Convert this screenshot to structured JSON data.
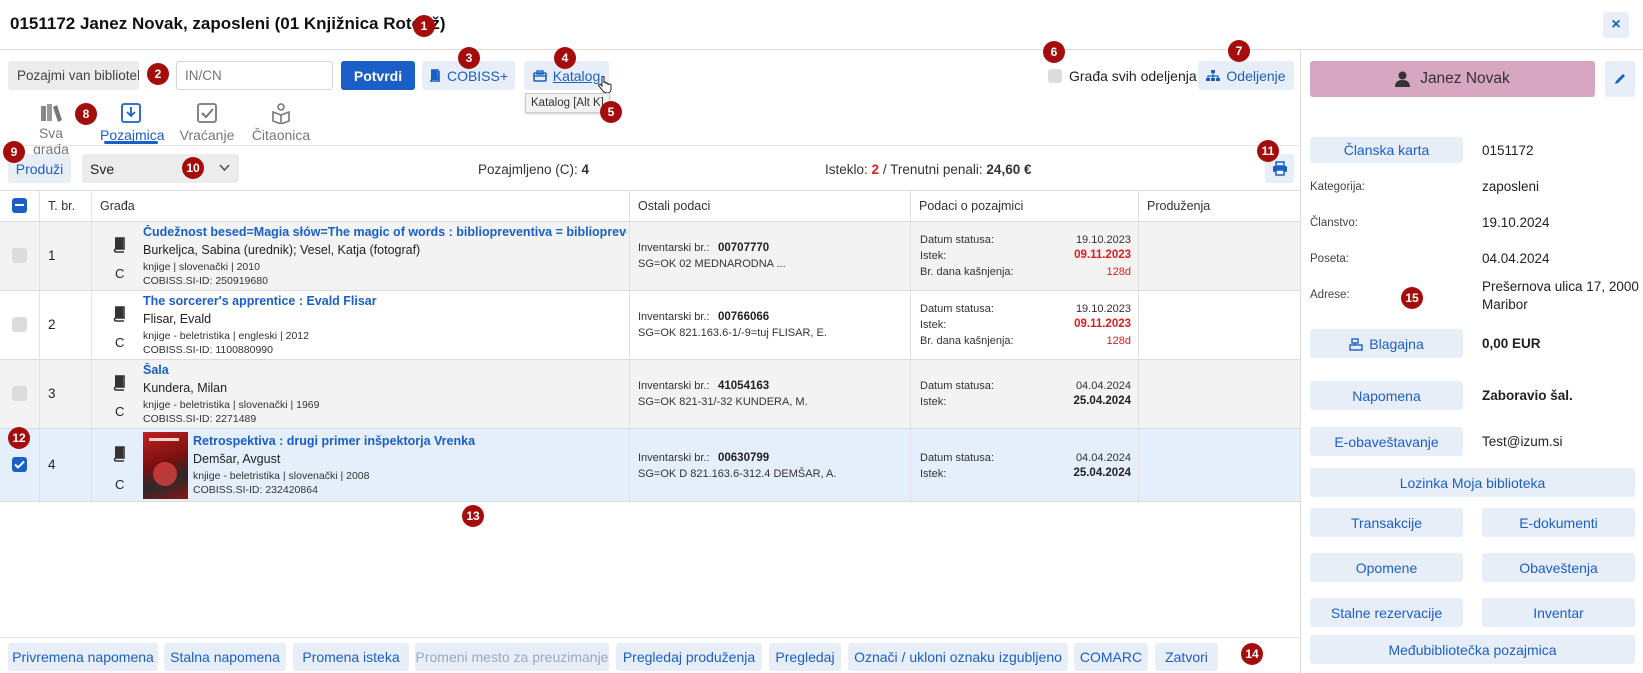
{
  "header": {
    "title": "0151172 Janez Novak, zaposleni (01 Knjižnica Rotovž)",
    "close_label": "×"
  },
  "toolbar": {
    "loan_select_value": "Pozajmi van bibliotek",
    "incn_placeholder": "IN/CN",
    "confirm_label": "Potvrdi",
    "cobiss_label": "COBISS+",
    "catalog_label": "Katalog",
    "catalog_tooltip": "Katalog [Alt K]",
    "all_departments_label": "Građa svih odeljenja",
    "department_label": "Odeljenje"
  },
  "tabs": [
    {
      "label": "Sva građa",
      "icon": "books-icon"
    },
    {
      "label": "Pozajmica",
      "icon": "download-icon"
    },
    {
      "label": "Vraćanje",
      "icon": "checkbox-icon"
    },
    {
      "label": "Čitaonica",
      "icon": "reader-icon"
    }
  ],
  "action_bar": {
    "extend_label": "Produži",
    "filter_value": "Sve",
    "borrowed_label": "Pozajmljeno (C):",
    "borrowed_count": "4",
    "expired_label": "Isteklo:",
    "expired_count": "2",
    "penalty_label": "/ Trenutni penali:",
    "penalty_value": "24,60 €"
  },
  "table": {
    "headers": [
      "T. br.",
      "Građa",
      "Ostali podaci",
      "Podaci o pozajmici",
      "Produženja"
    ],
    "rows": [
      {
        "no": "1",
        "title": "Čudežnost besed=Magia słów=The magic of words : bibliopreventiva = bibliopreventiva",
        "author": "Burkeljca, Sabina (urednik); Vesel, Katja (fotograf)",
        "meta": "knjige | slovenački | 2010",
        "cobiss": "COBISS.SI-ID: 250919680",
        "status": "C",
        "inv_label": "Inventarski br.:",
        "inv": "00707770",
        "sg": "SG=OK 02 MEDNARODNA ...",
        "date_label": "Datum statusa:",
        "date": "19.10.2023",
        "expiry_label": "Istek:",
        "expiry": "09.11.2023",
        "late_label": "Br. dana kašnjenja:",
        "late": "128d"
      },
      {
        "no": "2",
        "title": "The sorcerer's apprentice : Evald Flisar",
        "author": "Flisar, Evald",
        "meta": "knjige - beletristika | engleski | 2012",
        "cobiss": "COBISS.SI-ID: 1100880990",
        "status": "C",
        "inv_label": "Inventarski br.:",
        "inv": "00766066",
        "sg": "SG=OK 821.163.6-1/-9=tuj FLISAR, E.",
        "date_label": "Datum statusa:",
        "date": "19.10.2023",
        "expiry_label": "Istek:",
        "expiry": "09.11.2023",
        "late_label": "Br. dana kašnjenja:",
        "late": "128d"
      },
      {
        "no": "3",
        "title": "Šala",
        "author": "Kundera, Milan",
        "meta": "knjige - beletristika | slovenački | 1969",
        "cobiss": "COBISS.SI-ID: 2271489",
        "status": "C",
        "inv_label": "Inventarski br.:",
        "inv": "41054163",
        "sg": "SG=OK 821-31/-32 KUNDERA, M.",
        "date_label": "Datum statusa:",
        "date": "04.04.2024",
        "expiry_label": "Istek:",
        "expiry": "25.04.2024"
      },
      {
        "no": "4",
        "title": "Retrospektiva : drugi primer inšpektorja Vrenka",
        "author": "Demšar, Avgust",
        "meta": "knjige - beletristika | slovenački | 2008",
        "cobiss": "COBISS.SI-ID: 232420864",
        "status": "C",
        "inv_label": "Inventarski br.:",
        "inv": "00630799",
        "sg": "SG=OK D 821.163.6-312.4 DEMŠAR, A.",
        "date_label": "Datum statusa:",
        "date": "04.04.2024",
        "expiry_label": "Istek:",
        "expiry": "25.04.2024"
      }
    ]
  },
  "member": {
    "name": "Janez Novak",
    "card_label": "Članska karta",
    "card_value": "0151172",
    "category_label": "Kategorija:",
    "category_value": "zaposleni",
    "membership_label": "Članstvo:",
    "membership_value": "19.10.2024",
    "visit_label": "Poseta:",
    "visit_value": "04.04.2024",
    "address_label": "Adrese:",
    "address_line1": "Prešernova ulica 17, 2000",
    "address_line2": "Maribor",
    "cash_label": "Blagajna",
    "cash_value": "0,00 EUR",
    "note_label": "Napomena",
    "note_value": "Zaboravio šal.",
    "email_label": "E-obaveštavanje",
    "email_value": "Test@izum.si",
    "password_label": "Lozinka Moja biblioteka",
    "transactions_label": "Transakcije",
    "edocs_label": "E-dokumenti",
    "reminders_label": "Opomene",
    "notices_label": "Obaveštenja",
    "reservations_label": "Stalne rezervacije",
    "inventory_label": "Inventar",
    "ill_label": "Međubibliotečka pozajmica"
  },
  "bottom_bar": [
    "Privremena napomena",
    "Stalna napomena",
    "Promena isteka",
    "Promeni mesto za preuzimanje",
    "Pregledaj produženja",
    "Pregledaj",
    "Označi / ukloni oznaku izgubljeno",
    "COMARC",
    "Zatvori"
  ],
  "markers": [
    "1",
    "2",
    "3",
    "4",
    "5",
    "6",
    "7",
    "8",
    "9",
    "10",
    "11",
    "12",
    "13",
    "14",
    "15"
  ],
  "colors": {
    "accent": "#1a5fc7",
    "marker": "#a50d0d",
    "member_button": "#d7a6c0",
    "selected_row": "#e5effb",
    "expired": "#e01b1b"
  }
}
